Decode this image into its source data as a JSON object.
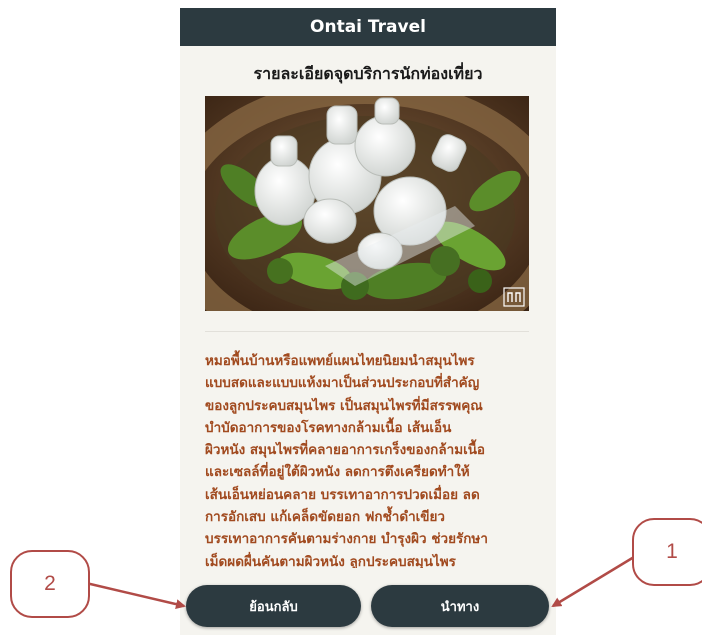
{
  "app": {
    "title": "Ontai Travel"
  },
  "page": {
    "title": "รายละเอียดจุดบริการนักท่องเที่ยว",
    "image_alt": "ลูกประคบสมุนไพรวางบนใบไม้ในถาดไม้"
  },
  "description": "หมอพื้นบ้านหรือแพทย์แผนไทยนิยมนำสมุนไพร\nแบบสดและแบบแห้งมาเป็นส่วนประกอบที่สำคัญ\nของลูกประคบสมุนไพร เป็นสมุนไพรที่มีสรรพคุณ\nบำบัดอาการของโรคทางกล้ามเนื้อ เส้นเอ็น\nผิวหนัง สมุนไพรที่คลายอาการเกร็งของกล้ามเนื้อ\nและเซลล์ที่อยู่ใต้ผิวหนัง ลดการตึงเครียดทำให้\nเส้นเอ็นหย่อนคลาย บรรเทาอาการปวดเมื่อย ลด\nการอักเสบ แก้เคล็ดขัดยอก ฟกช้ำดำเขียว\nบรรเทาอาการคันตามร่างกาย บำรุงผิว ช่วยรักษา\nเม็ดผดผื่นคันตามผิวหนัง ลูกประคบสมุนไพร",
  "buttons": {
    "back_label": "ย้อนกลับ",
    "navigate_label": "นำทาง"
  },
  "annotations": {
    "callout_1": "1",
    "callout_2": "2"
  },
  "colors": {
    "header_bg": "#2c3a40",
    "description_text": "#a14a1f",
    "annotation": "#b14b47"
  }
}
